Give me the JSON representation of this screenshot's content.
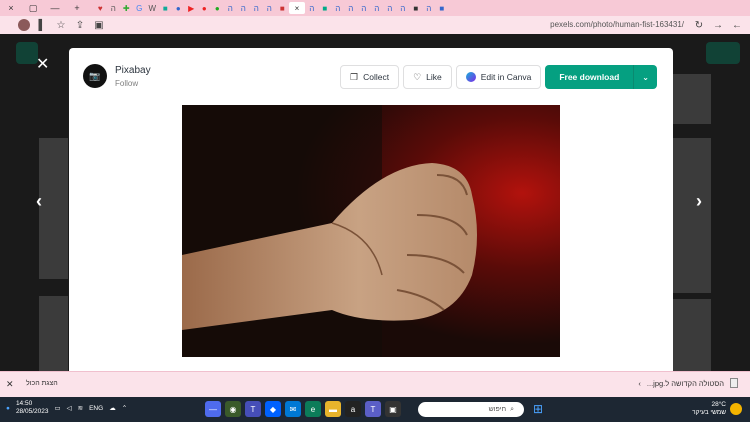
{
  "browser": {
    "url": "pexels.com/photo/human-fist-163431/",
    "window_controls": [
      "×",
      "▢",
      "—",
      "+"
    ]
  },
  "modal": {
    "author": {
      "name": "Pixabay",
      "follow_label": "Follow",
      "avatar_text": "📷"
    },
    "buttons": {
      "collect": "Collect",
      "like": "Like",
      "edit_canva": "Edit in Canva",
      "download": "Free download"
    },
    "accent_color": "#05a081"
  },
  "download_bar": {
    "show_all": "הצגת הכול",
    "file_name": "...jpg.הסטולה הקדושה ל"
  },
  "taskbar": {
    "time": "14:50",
    "date": "28/05/2023",
    "lang": "ENG",
    "search_placeholder": "חיפוש",
    "weather_temp": "28°C",
    "weather_desc": "שמשי בעיקר"
  }
}
